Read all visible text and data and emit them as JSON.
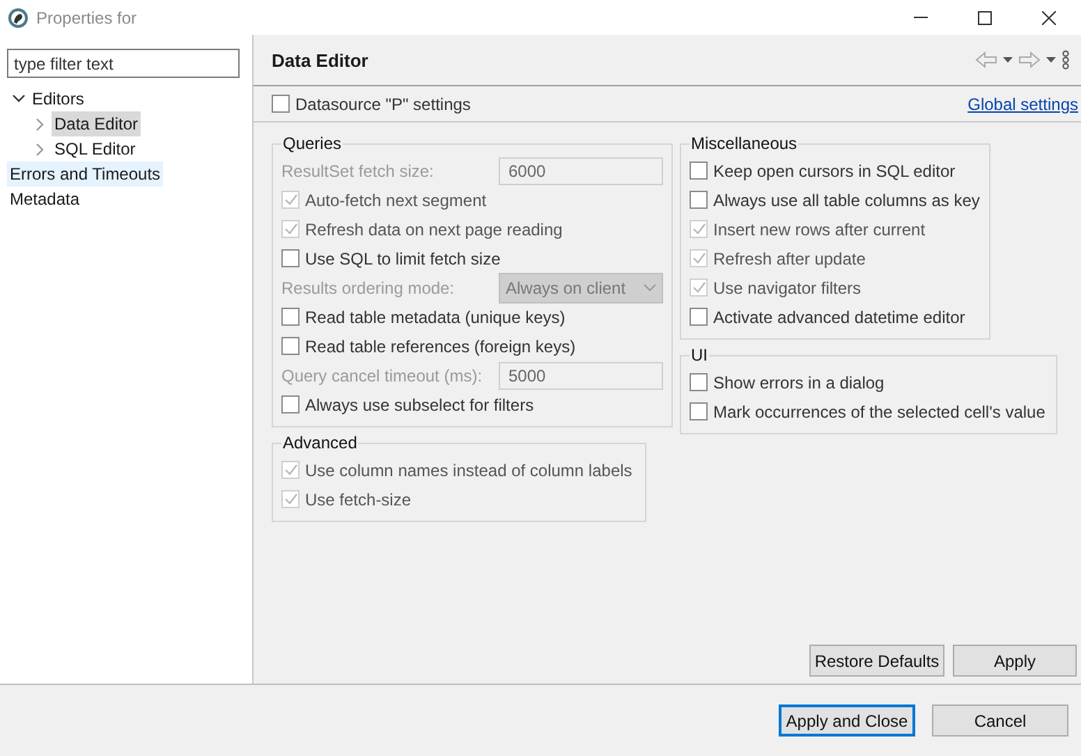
{
  "window": {
    "title": "Properties for"
  },
  "filter": {
    "placeholder": "type filter text"
  },
  "tree": [
    {
      "label": "Editors",
      "expanded": true,
      "selected": false,
      "highlighted": false,
      "children": [
        {
          "label": "Data Editor",
          "expanded": false,
          "selected": true,
          "highlighted": false
        },
        {
          "label": "SQL Editor",
          "expanded": false,
          "selected": false,
          "highlighted": false
        }
      ]
    },
    {
      "label": "Errors and Timeouts",
      "selected": false,
      "highlighted": true
    },
    {
      "label": "Metadata",
      "selected": false,
      "highlighted": false
    }
  ],
  "page": {
    "title": "Data Editor",
    "datasource": {
      "label": "Datasource \"P\" settings",
      "checked": false
    },
    "global_link": "Global settings"
  },
  "queries": {
    "title": "Queries",
    "items": [
      {
        "kind": "field",
        "label": "ResultSet fetch size:",
        "value": "6000"
      },
      {
        "kind": "check",
        "label": "Auto-fetch next segment",
        "checked": true,
        "disabled": true
      },
      {
        "kind": "check",
        "label": "Refresh data on next page reading",
        "checked": true,
        "disabled": true
      },
      {
        "kind": "check",
        "label": "Use SQL to limit fetch size",
        "checked": false,
        "disabled": false
      },
      {
        "kind": "select",
        "label": "Results ordering mode:",
        "value": "Always on client"
      },
      {
        "kind": "check",
        "label": "Read table metadata (unique keys)",
        "checked": false,
        "disabled": false
      },
      {
        "kind": "check",
        "label": "Read table references (foreign keys)",
        "checked": false,
        "disabled": false
      },
      {
        "kind": "field",
        "label": "Query cancel timeout (ms):",
        "value": "5000"
      },
      {
        "kind": "check",
        "label": "Always use subselect for filters",
        "checked": false,
        "disabled": false
      }
    ]
  },
  "advanced": {
    "title": "Advanced",
    "items": [
      {
        "kind": "check",
        "label": "Use column names instead of column labels",
        "checked": true,
        "disabled": true
      },
      {
        "kind": "check",
        "label": "Use fetch-size",
        "checked": true,
        "disabled": true
      }
    ]
  },
  "miscellaneous": {
    "title": "Miscellaneous",
    "items": [
      {
        "kind": "check",
        "label": "Keep open cursors in SQL editor",
        "checked": false,
        "disabled": false
      },
      {
        "kind": "check",
        "label": "Always use all table columns as key",
        "checked": false,
        "disabled": false
      },
      {
        "kind": "check",
        "label": "Insert new rows after current",
        "checked": true,
        "disabled": true
      },
      {
        "kind": "check",
        "label": "Refresh after update",
        "checked": true,
        "disabled": true
      },
      {
        "kind": "check",
        "label": "Use navigator filters",
        "checked": true,
        "disabled": true
      },
      {
        "kind": "check",
        "label": "Activate advanced datetime editor",
        "checked": false,
        "disabled": false
      }
    ]
  },
  "ui": {
    "title": "UI",
    "items": [
      {
        "kind": "check",
        "label": "Show errors in a dialog",
        "checked": false,
        "disabled": false
      },
      {
        "kind": "check",
        "label": "Mark occurrences of the selected cell's value",
        "checked": false,
        "disabled": false
      }
    ]
  },
  "page_buttons": [
    "Restore Defaults",
    "Apply"
  ],
  "dialog_buttons": [
    {
      "label": "Apply and Close",
      "default": true
    },
    {
      "label": "Cancel",
      "default": false
    }
  ]
}
